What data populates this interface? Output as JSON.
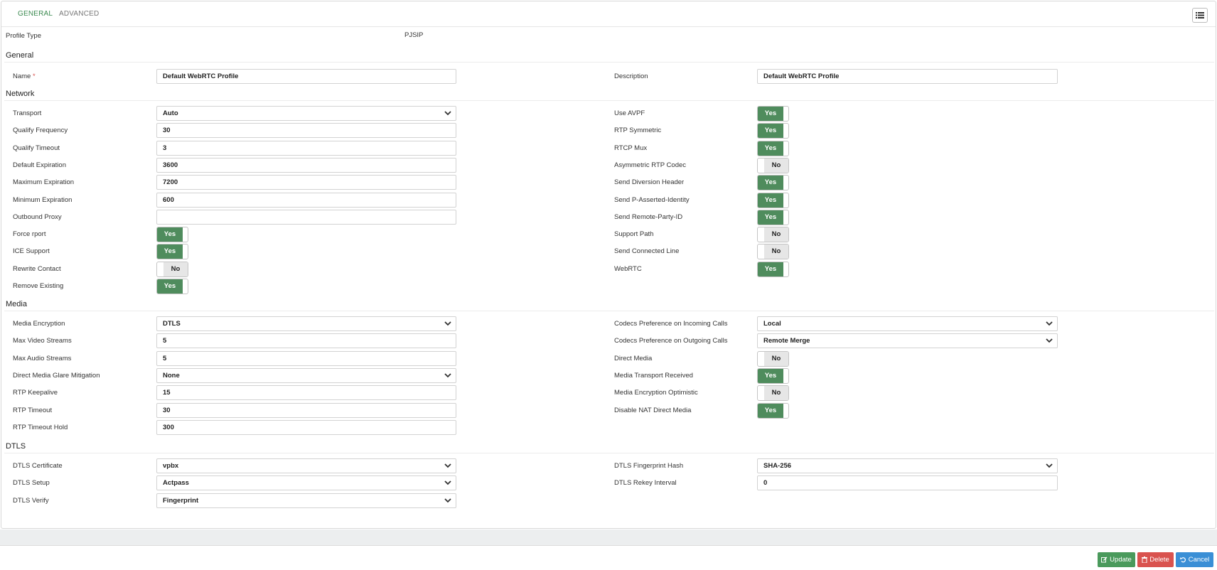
{
  "tabs": {
    "general": "GENERAL",
    "advanced": "ADVANCED"
  },
  "profile_type": {
    "label": "Profile Type",
    "value": "PJSIP"
  },
  "sections": {
    "general": "General",
    "network": "Network",
    "media": "Media",
    "dtls": "DTLS"
  },
  "general": {
    "name": {
      "label": "Name",
      "required_mark": "*",
      "value": "Default WebRTC Profile"
    },
    "description": {
      "label": "Description",
      "value": "Default WebRTC Profile"
    }
  },
  "network": {
    "left": [
      {
        "label": "Transport",
        "value": "Auto"
      },
      {
        "label": "Qualify Frequency",
        "value": "30"
      },
      {
        "label": "Qualify Timeout",
        "value": "3"
      },
      {
        "label": "Default Expiration",
        "value": "3600"
      },
      {
        "label": "Maximum Expiration",
        "value": "7200"
      },
      {
        "label": "Minimum Expiration",
        "value": "600"
      },
      {
        "label": "Outbound Proxy",
        "value": ""
      },
      {
        "label": "Force rport",
        "value": "Yes"
      },
      {
        "label": "ICE Support",
        "value": "Yes"
      },
      {
        "label": "Rewrite Contact",
        "value": "No"
      },
      {
        "label": "Remove Existing",
        "value": "Yes"
      }
    ],
    "right": [
      {
        "label": "Use AVPF",
        "value": "Yes"
      },
      {
        "label": "RTP Symmetric",
        "value": "Yes"
      },
      {
        "label": "RTCP Mux",
        "value": "Yes"
      },
      {
        "label": "Asymmetric RTP Codec",
        "value": "No"
      },
      {
        "label": "Send Diversion Header",
        "value": "Yes"
      },
      {
        "label": "Send P-Asserted-Identity",
        "value": "Yes"
      },
      {
        "label": "Send Remote-Party-ID",
        "value": "Yes"
      },
      {
        "label": "Support Path",
        "value": "No"
      },
      {
        "label": "Send Connected Line",
        "value": "No"
      },
      {
        "label": "WebRTC",
        "value": "Yes"
      }
    ]
  },
  "media": {
    "left": [
      {
        "label": "Media Encryption",
        "value": "DTLS"
      },
      {
        "label": "Max Video Streams",
        "value": "5"
      },
      {
        "label": "Max Audio Streams",
        "value": "5"
      },
      {
        "label": "Direct Media Glare Mitigation",
        "value": "None"
      },
      {
        "label": "RTP Keepalive",
        "value": "15"
      },
      {
        "label": "RTP Timeout",
        "value": "30"
      },
      {
        "label": "RTP Timeout Hold",
        "value": "300"
      }
    ],
    "right": [
      {
        "label": "Codecs Preference on Incoming Calls",
        "value": "Local"
      },
      {
        "label": "Codecs Preference on Outgoing Calls",
        "value": "Remote Merge"
      },
      {
        "label": "Direct Media",
        "value": "No"
      },
      {
        "label": "Media Transport Received",
        "value": "Yes"
      },
      {
        "label": "Media Encryption Optimistic",
        "value": "No"
      },
      {
        "label": "Disable NAT Direct Media",
        "value": "Yes"
      }
    ]
  },
  "dtls": {
    "left": [
      {
        "label": "DTLS Certificate",
        "value": "vpbx"
      },
      {
        "label": "DTLS Setup",
        "value": "Actpass"
      },
      {
        "label": "DTLS Verify",
        "value": "Fingerprint"
      }
    ],
    "right": [
      {
        "label": "DTLS Fingerprint Hash",
        "value": "SHA-256"
      },
      {
        "label": "DTLS Rekey Interval",
        "value": "0"
      }
    ]
  },
  "buttons": {
    "update": "Update",
    "delete": "Delete",
    "cancel": "Cancel"
  },
  "icons": {
    "menu": "list-icon",
    "update": "edit-icon",
    "delete": "trash-icon",
    "cancel": "undo-icon",
    "dropdown": "chevron-down-icon"
  },
  "colors": {
    "accent": "#3c8a50",
    "toggle_on": "#4f8c5d",
    "update": "#4a9a5c",
    "delete": "#d9534f",
    "cancel": "#3a8fd6"
  }
}
